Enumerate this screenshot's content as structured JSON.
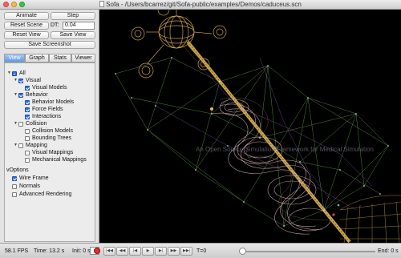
{
  "window": {
    "title": "Sofa - /Users/bcarrez/git/Sofa-public/examples/Demos/caduceus.scn",
    "traffic_lights": [
      "close",
      "minimize",
      "maximize"
    ]
  },
  "controls": {
    "animate": "Animate",
    "step": "Step",
    "reset_scene": "Reset Scene",
    "dt_label": "DT:",
    "dt_value": "0.04",
    "reset_view": "Reset View",
    "save_view": "Save View",
    "save_screenshot": "Save Screenshot"
  },
  "tabs": [
    {
      "label": "View",
      "active": true
    },
    {
      "label": "Graph",
      "active": false
    },
    {
      "label": "Stats",
      "active": false
    },
    {
      "label": "Viewer",
      "active": false
    }
  ],
  "tree": [
    {
      "label": "All",
      "state": "partial",
      "arrow": true
    },
    {
      "label": "Visual",
      "state": "on",
      "arrow": true
    },
    {
      "label": "Visual Models",
      "state": "on",
      "arrow": false
    },
    {
      "label": "Behavior",
      "state": "on",
      "arrow": true
    },
    {
      "label": "Behavior Models",
      "state": "on",
      "arrow": false
    },
    {
      "label": "Force Fields",
      "state": "on",
      "arrow": false
    },
    {
      "label": "Interactions",
      "state": "on",
      "arrow": false
    },
    {
      "label": "Collision",
      "state": "off",
      "arrow": true
    },
    {
      "label": "Collision Models",
      "state": "off",
      "arrow": false
    },
    {
      "label": "Bounding Trees",
      "state": "off",
      "arrow": false
    },
    {
      "label": "Mapping",
      "state": "off",
      "arrow": true
    },
    {
      "label": "Visual Mappings",
      "state": "off",
      "arrow": false
    },
    {
      "label": "Mechanical Mappings",
      "state": "off",
      "arrow": false
    }
  ],
  "options": {
    "header": "vOptions",
    "items": [
      {
        "label": "Wire Frame",
        "state": "on"
      },
      {
        "label": "Normals",
        "state": "off"
      },
      {
        "label": "Advanced Rendering",
        "state": "off"
      }
    ]
  },
  "viewport": {
    "overlay_text": "An Open Source Simulation Framework for Medical Simulation"
  },
  "status": {
    "fps": "58.1 FPS",
    "time": "Time: 13.2 s",
    "init": "Init: 0 s",
    "t_label": "T=0",
    "end": "End: 0 s"
  },
  "colors": {
    "viewport_bg": "#000000",
    "wire_gold": "#c9a34a",
    "wire_pink": "#d9b0b0",
    "wire_green": "#6fae5a",
    "tab_active": "#5f9be6",
    "record": "#d33333"
  },
  "icons": {
    "record": "record-icon",
    "first": "skip-first-icon",
    "step_back": "step-back-icon",
    "prev": "previous-icon",
    "play": "play-icon",
    "next": "next-icon",
    "step_forward": "step-forward-icon",
    "last": "skip-last-icon"
  }
}
